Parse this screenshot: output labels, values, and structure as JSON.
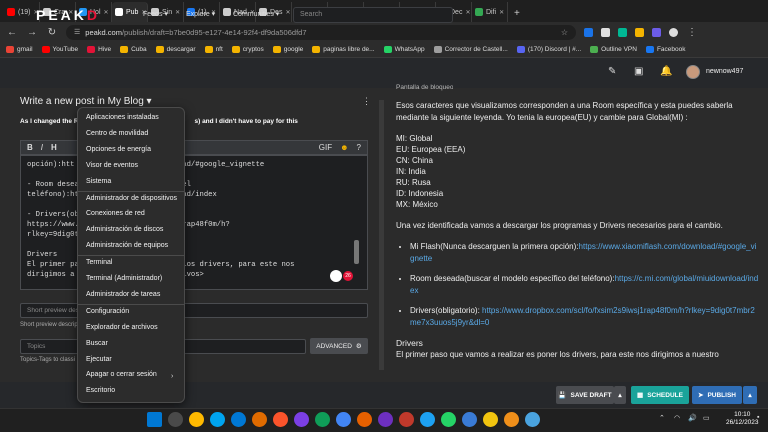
{
  "browser": {
    "tabs": [
      {
        "label": "(19)",
        "color": "#ff0000"
      },
      {
        "label": "Cra",
        "color": "#cccccc"
      },
      {
        "label": "Hol",
        "color": "#2196f3"
      },
      {
        "label": "Pub",
        "color": "#ffffff",
        "active": true
      },
      {
        "label": "Sin",
        "color": "#cccccc"
      },
      {
        "label": "(1)",
        "color": "#1877f2"
      },
      {
        "label": "Nad",
        "color": "#cccccc"
      },
      {
        "label": "Des",
        "color": "#cccccc"
      },
      {
        "label": "Dov",
        "color": "#d9534f"
      },
      {
        "label": "Xiao",
        "color": "#ff6900"
      },
      {
        "label": "App",
        "color": "#e53935"
      },
      {
        "label": "Cor",
        "color": "#3f51b5"
      },
      {
        "label": "Dec",
        "color": "#cccccc"
      },
      {
        "label": "Difi",
        "color": "#34a853"
      }
    ],
    "url_domain": "peakd.com",
    "url_path": "/publish/draft=b7be0d95-e127-4e14-92f4-df9da506dfd7",
    "bookmarks": [
      "gmail",
      "YouTube",
      "Hive",
      "Cuba",
      "descargar",
      "nft",
      "cryptos",
      "google",
      "paginas libre de...",
      "WhatsApp",
      "Corrector de Castell...",
      "(170) Discord | #...",
      "Outline VPN",
      "Facebook"
    ]
  },
  "peakd": {
    "logo_main": "PEAK",
    "logo_accent": "D",
    "nav": [
      "Feeds",
      "Explore",
      "Communities"
    ],
    "search_placeholder": "Search",
    "username": "newnow497"
  },
  "editor": {
    "title": "Write a new post in My Blog",
    "header_text_left": "As I changed the Ro",
    "header_text_right": "s) and I didn't have to pay for this",
    "toolbar_left": [
      "B",
      "I",
      "H"
    ],
    "toolbar_right": [
      "GIF"
    ],
    "body_lines": [
      "opción):htt                   download/#google_vignette",
      "",
      "- Room desea                 ifico del",
      "teléfono):ht                 idownload/index",
      "",
      "- Drivers(ob",
      "https://www.                 s9iwsj1rap48f0m/h?",
      "rlkey=9dig0t",
      "",
      "Drivers",
      "El primer pa                s poner los drivers, para este nos",
      "dirigimos a                 dispositivos>"
    ],
    "short_preview_placeholder": "Short preview des",
    "short_preview_help": "Short preview descrip",
    "topics_placeholder": "Topics",
    "topics_help": "Topics-Tags to classi",
    "advanced_label": "ADVANCED",
    "counter_badge": "26"
  },
  "preview": {
    "header": "Pantalla de bloqueo",
    "intro": "Esos caracteres que visualizamos corresponden a una Room específica y esta puedes saberla mediante la siguiente leyenda. Yo tenia la europea(EU) y cambie para Global(MI) :",
    "regions": [
      "MI: Global",
      "EU: Europea (EEA)",
      "CN: China",
      "IN: India",
      "RU: Rusa",
      "ID: Indonesia",
      "MX: México"
    ],
    "after_regions": "Una vez identificada vamos a descargar los programas y Drivers necesarios para el cambio.",
    "items": [
      {
        "text": "Mi Flash(Nunca descarguen la primera opción):",
        "link": "https://www.xiaomiflash.com/download/#google_vignette"
      },
      {
        "text": "Room deseada(buscar el modelo específico del teléfono):",
        "link": "https://c.mi.com/global/miuidownload/index"
      },
      {
        "text": "Drivers(obligatorio): ",
        "link": "https://www.dropbox.com/scl/fo/fxsim2s9iwsj1rap48f0m/h?rlkey=9dig0t7mbr2me7x3uuos5j9yr&dl=0"
      }
    ],
    "drivers_heading": "Drivers",
    "drivers_text": "El primer paso que vamos a realizar es poner los drivers, para este nos dirigimos a nuestro"
  },
  "actions": {
    "save_draft": "SAVE DRAFT",
    "schedule": "SCHEDULE",
    "publish": "PUBLISH"
  },
  "context_menu": {
    "items": [
      "Aplicaciones instaladas",
      "Centro de movilidad",
      "Opciones de energía",
      "Visor de eventos",
      "Sistema",
      "Administrador de dispositivos",
      "Conexiones de red",
      "Administración de discos",
      "Administración de equipos",
      "Terminal",
      "Terminal (Administrador)",
      "Administrador de tareas",
      "Configuración",
      "Explorador de archivos",
      "Buscar",
      "Ejecutar",
      "Apagar o cerrar sesión",
      "Escritorio"
    ]
  },
  "taskbar": {
    "language": "ESP",
    "time": "10:10",
    "date": "26/12/2023"
  },
  "colors": {
    "accent_red": "#e31337",
    "schedule_teal": "#1aa39a",
    "publish_blue": "#2f6db5",
    "link_blue": "#5aa9e6"
  }
}
